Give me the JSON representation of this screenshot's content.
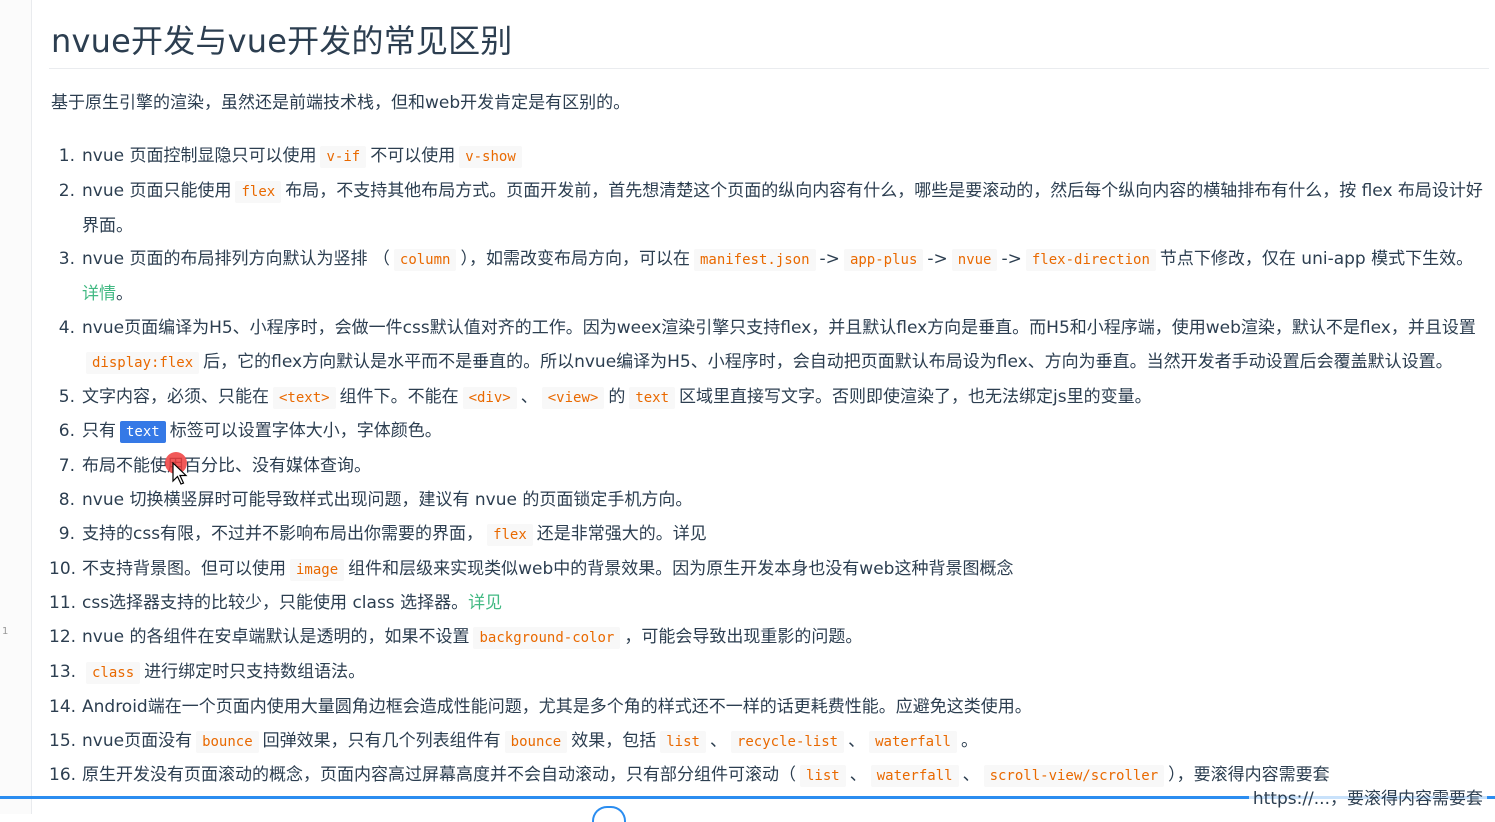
{
  "heading": "nvue开发与vue开发的常见区别",
  "intro": "基于原生引擎的渲染，虽然还是前端技术栈，但和web开发肯定是有区别的。",
  "items": [
    {
      "num": "1.",
      "parts": [
        {
          "t": "nvue 页面控制显隐只可以使用"
        },
        {
          "c": "v-if"
        },
        {
          "t": "不可以使用"
        },
        {
          "c": "v-show"
        }
      ]
    },
    {
      "num": "2.",
      "parts": [
        {
          "t": "nvue 页面只能使用"
        },
        {
          "c": "flex"
        },
        {
          "t": "布局，不支持其他布局方式。页面开发前，首先想清楚这个页面的纵向内容有什么，哪些是要滚动的，然后每个纵向内容的横轴排布有什么，按 flex 布局设计好界面。"
        }
      ]
    },
    {
      "num": "3.",
      "parts": [
        {
          "t": "nvue 页面的布局排列方向默认为竖排 （"
        },
        {
          "c": "column"
        },
        {
          "t": "），如需改变布局方向，可以在"
        },
        {
          "c": "manifest.json"
        },
        {
          "t": "->"
        },
        {
          "c": "app-plus"
        },
        {
          "t": "->"
        },
        {
          "c": "nvue"
        },
        {
          "t": "->"
        },
        {
          "c": "flex-direction"
        },
        {
          "t": "节点下修改，仅在 uni-app 模式下生效。"
        },
        {
          "l": "详情"
        },
        {
          "t": "。"
        }
      ]
    },
    {
      "num": "4.",
      "parts": [
        {
          "t": "nvue页面编译为H5、小程序时，会做一件css默认值对齐的工作。因为weex渲染引擎只支持flex，并且默认flex方向是垂直。而H5和小程序端，使用web渲染，默认不是flex，并且设置"
        },
        {
          "c": "display:flex"
        },
        {
          "t": "后，它的flex方向默认是水平而不是垂直的。所以nvue编译为H5、小程序时，会自动把页面默认布局设为flex、方向为垂直。当然开发者手动设置后会覆盖默认设置。"
        }
      ]
    },
    {
      "num": "5.",
      "parts": [
        {
          "t": "文字内容，必须、只能在"
        },
        {
          "c": "<text>"
        },
        {
          "t": "组件下。不能在"
        },
        {
          "c": "<div>"
        },
        {
          "t": "、"
        },
        {
          "c": "<view>"
        },
        {
          "t": "的"
        },
        {
          "c": "text"
        },
        {
          "t": "区域里直接写文字。否则即使渲染了，也无法绑定js里的变量。"
        }
      ]
    },
    {
      "num": "6.",
      "parts": [
        {
          "t": "只有"
        },
        {
          "c": "text",
          "sel": true
        },
        {
          "t": "标签可以设置字体大小，字体颜色。"
        }
      ]
    },
    {
      "num": "7.",
      "parts": [
        {
          "t": "布局不能使用百分比、没有媒体查询。"
        }
      ]
    },
    {
      "num": "8.",
      "parts": [
        {
          "t": "nvue 切换横竖屏时可能导致样式出现问题，建议有 nvue 的页面锁定手机方向。"
        }
      ]
    },
    {
      "num": "9.",
      "parts": [
        {
          "t": "支持的css有限，不过并不影响布局出你需要的界面，"
        },
        {
          "c": "flex"
        },
        {
          "t": "还是非常强大的。详见"
        }
      ]
    },
    {
      "num": "10.",
      "parts": [
        {
          "t": "不支持背景图。但可以使用"
        },
        {
          "c": "image"
        },
        {
          "t": "组件和层级来实现类似web中的背景效果。因为原生开发本身也没有web这种背景图概念"
        }
      ]
    },
    {
      "num": "11.",
      "parts": [
        {
          "t": "css选择器支持的比较少，只能使用 class 选择器。"
        },
        {
          "l": "详见"
        }
      ]
    },
    {
      "num": "12.",
      "parts": [
        {
          "t": "nvue 的各组件在安卓端默认是透明的，如果不设置"
        },
        {
          "c": "background-color"
        },
        {
          "t": "，可能会导致出现重影的问题。"
        }
      ]
    },
    {
      "num": "13.",
      "parts": [
        {
          "c": "class"
        },
        {
          "t": "进行绑定时只支持数组语法。"
        }
      ]
    },
    {
      "num": "14.",
      "parts": [
        {
          "t": "Android端在一个页面内使用大量圆角边框会造成性能问题，尤其是多个角的样式还不一样的话更耗费性能。应避免这类使用。"
        }
      ]
    },
    {
      "num": "15.",
      "parts": [
        {
          "t": "nvue页面没有"
        },
        {
          "c": "bounce"
        },
        {
          "t": "回弹效果，只有几个列表组件有"
        },
        {
          "c": "bounce"
        },
        {
          "t": "效果，包括"
        },
        {
          "c": "list"
        },
        {
          "t": "、"
        },
        {
          "c": "recycle-list"
        },
        {
          "t": "、"
        },
        {
          "c": "waterfall"
        },
        {
          "t": "。"
        }
      ]
    },
    {
      "num": "16.",
      "parts": [
        {
          "t": "原生开发没有页面滚动的概念，页面内容高过屏幕高度并不会自动滚动，只有部分组件可滚动（"
        },
        {
          "c": "list"
        },
        {
          "t": "、"
        },
        {
          "c": "waterfall"
        },
        {
          "t": "、"
        },
        {
          "c": "scroll-view/scroller"
        },
        {
          "t": "），要滚得内容需要套"
        }
      ]
    }
  ],
  "overlay": {
    "watermark": "https://...，要滚得内容需要套",
    "gutter_mark": "1"
  },
  "colors": {
    "text": "#2c3e50",
    "code": "#e96900",
    "code_bg": "#f8f8f8",
    "link": "#42b983",
    "selection": "#3579e6",
    "accent": "#2b8df0"
  }
}
